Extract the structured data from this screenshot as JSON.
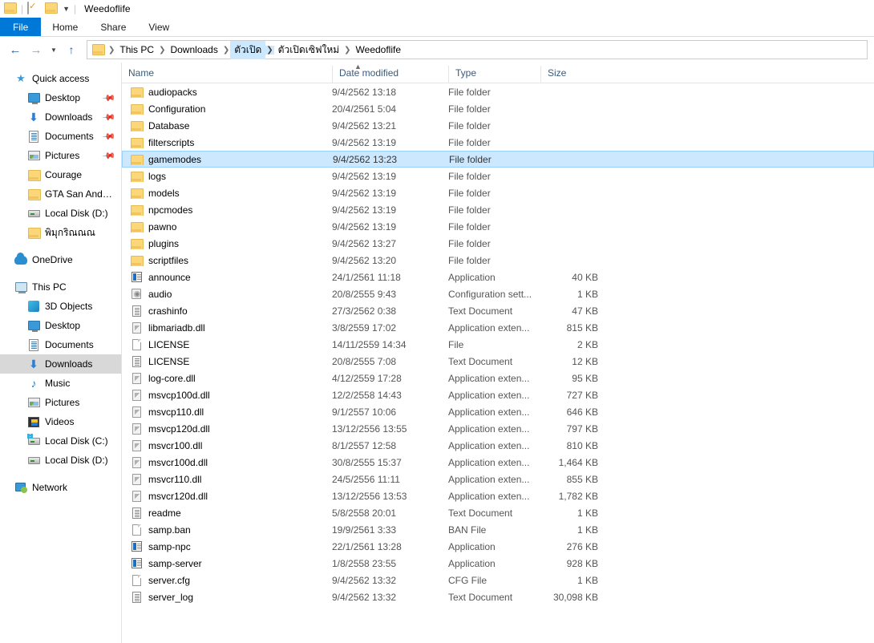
{
  "titlebar": {
    "title": "Weedoflife",
    "qat": [
      "folder-icon",
      "properties-icon",
      "new-folder-icon",
      "customize-dropdown-icon"
    ]
  },
  "ribbon": {
    "tabs": [
      {
        "label": "File",
        "active": true
      },
      {
        "label": "Home",
        "active": false
      },
      {
        "label": "Share",
        "active": false
      },
      {
        "label": "View",
        "active": false
      }
    ]
  },
  "addressbar": {
    "back_icon": "back-arrow-icon",
    "forward_icon": "forward-arrow-icon",
    "recent_icon": "recent-locations-icon",
    "up_icon": "up-arrow-icon",
    "crumbs": [
      {
        "label": "This PC",
        "highlight": false
      },
      {
        "label": "Downloads",
        "highlight": false
      },
      {
        "label": "ตัวเปิด",
        "highlight": true
      },
      {
        "label": "ตัวเปิดเซิฟใหม่",
        "highlight": false
      },
      {
        "label": "Weedoflife",
        "highlight": false
      }
    ]
  },
  "navpane": {
    "items": [
      {
        "label": "Quick access",
        "icon": "star-icon",
        "level": 0,
        "pinned": false,
        "selected": false
      },
      {
        "label": "Desktop",
        "icon": "monitor-icon",
        "level": 1,
        "pinned": true,
        "selected": false
      },
      {
        "label": "Downloads",
        "icon": "download-arrow-icon",
        "level": 1,
        "pinned": true,
        "selected": false
      },
      {
        "label": "Documents",
        "icon": "document-icon",
        "level": 1,
        "pinned": true,
        "selected": false
      },
      {
        "label": "Pictures",
        "icon": "picture-icon",
        "level": 1,
        "pinned": true,
        "selected": false
      },
      {
        "label": "Courage",
        "icon": "folder-icon",
        "level": 1,
        "pinned": false,
        "selected": false
      },
      {
        "label": "GTA San Andreas",
        "icon": "folder-icon",
        "level": 1,
        "pinned": false,
        "selected": false
      },
      {
        "label": "Local Disk (D:)",
        "icon": "drive-icon",
        "level": 1,
        "pinned": false,
        "selected": false
      },
      {
        "label": "พิมุกริณณณ",
        "icon": "folder-icon",
        "level": 1,
        "pinned": false,
        "selected": false
      },
      {
        "gap": true
      },
      {
        "label": "OneDrive",
        "icon": "cloud-icon",
        "level": 0,
        "pinned": false,
        "selected": false
      },
      {
        "gap": true
      },
      {
        "label": "This PC",
        "icon": "pc-icon",
        "level": 0,
        "pinned": false,
        "selected": false
      },
      {
        "label": "3D Objects",
        "icon": "3d-objects-icon",
        "level": 1,
        "pinned": false,
        "selected": false
      },
      {
        "label": "Desktop",
        "icon": "monitor-icon",
        "level": 1,
        "pinned": false,
        "selected": false
      },
      {
        "label": "Documents",
        "icon": "document-icon",
        "level": 1,
        "pinned": false,
        "selected": false
      },
      {
        "label": "Downloads",
        "icon": "download-arrow-icon",
        "level": 1,
        "pinned": false,
        "selected": true
      },
      {
        "label": "Music",
        "icon": "music-note-icon",
        "level": 1,
        "pinned": false,
        "selected": false
      },
      {
        "label": "Pictures",
        "icon": "picture-icon",
        "level": 1,
        "pinned": false,
        "selected": false
      },
      {
        "label": "Videos",
        "icon": "video-icon",
        "level": 1,
        "pinned": false,
        "selected": false
      },
      {
        "label": "Local Disk (C:)",
        "icon": "system-drive-icon",
        "level": 1,
        "pinned": false,
        "selected": false
      },
      {
        "label": "Local Disk (D:)",
        "icon": "drive-icon",
        "level": 1,
        "pinned": false,
        "selected": false
      },
      {
        "gap": true
      },
      {
        "label": "Network",
        "icon": "network-icon",
        "level": 0,
        "pinned": false,
        "selected": false
      }
    ]
  },
  "listview": {
    "columns": [
      {
        "key": "name",
        "label": "Name",
        "sort": "asc"
      },
      {
        "key": "date",
        "label": "Date modified",
        "sort": ""
      },
      {
        "key": "type",
        "label": "Type",
        "sort": ""
      },
      {
        "key": "size",
        "label": "Size",
        "sort": ""
      }
    ],
    "rows": [
      {
        "name": "audiopacks",
        "date": "9/4/2562 13:18",
        "type": "File folder",
        "size": "",
        "icon": "folder-icon",
        "selected": false
      },
      {
        "name": "Configuration",
        "date": "20/4/2561 5:04",
        "type": "File folder",
        "size": "",
        "icon": "folder-icon",
        "selected": false
      },
      {
        "name": "Database",
        "date": "9/4/2562 13:21",
        "type": "File folder",
        "size": "",
        "icon": "folder-icon",
        "selected": false
      },
      {
        "name": "filterscripts",
        "date": "9/4/2562 13:19",
        "type": "File folder",
        "size": "",
        "icon": "folder-icon",
        "selected": false
      },
      {
        "name": "gamemodes",
        "date": "9/4/2562 13:23",
        "type": "File folder",
        "size": "",
        "icon": "folder-icon",
        "selected": true
      },
      {
        "name": "logs",
        "date": "9/4/2562 13:19",
        "type": "File folder",
        "size": "",
        "icon": "folder-icon",
        "selected": false
      },
      {
        "name": "models",
        "date": "9/4/2562 13:19",
        "type": "File folder",
        "size": "",
        "icon": "folder-icon",
        "selected": false
      },
      {
        "name": "npcmodes",
        "date": "9/4/2562 13:19",
        "type": "File folder",
        "size": "",
        "icon": "folder-icon",
        "selected": false
      },
      {
        "name": "pawno",
        "date": "9/4/2562 13:19",
        "type": "File folder",
        "size": "",
        "icon": "folder-icon",
        "selected": false
      },
      {
        "name": "plugins",
        "date": "9/4/2562 13:27",
        "type": "File folder",
        "size": "",
        "icon": "folder-icon",
        "selected": false
      },
      {
        "name": "scriptfiles",
        "date": "9/4/2562 13:20",
        "type": "File folder",
        "size": "",
        "icon": "folder-icon",
        "selected": false
      },
      {
        "name": "announce",
        "date": "24/1/2561 11:18",
        "type": "Application",
        "size": "40 KB",
        "icon": "application-icon",
        "selected": false
      },
      {
        "name": "audio",
        "date": "20/8/2555 9:43",
        "type": "Configuration sett...",
        "size": "1 KB",
        "icon": "config-icon",
        "selected": false
      },
      {
        "name": "crashinfo",
        "date": "27/3/2562 0:38",
        "type": "Text Document",
        "size": "47 KB",
        "icon": "text-document-icon",
        "selected": false
      },
      {
        "name": "libmariadb.dll",
        "date": "3/8/2559 17:02",
        "type": "Application exten...",
        "size": "815 KB",
        "icon": "dll-icon",
        "selected": false
      },
      {
        "name": "LICENSE",
        "date": "14/11/2559 14:34",
        "type": "File",
        "size": "2 KB",
        "icon": "blank-file-icon",
        "selected": false
      },
      {
        "name": "LICENSE",
        "date": "20/8/2555 7:08",
        "type": "Text Document",
        "size": "12 KB",
        "icon": "text-document-icon",
        "selected": false
      },
      {
        "name": "log-core.dll",
        "date": "4/12/2559 17:28",
        "type": "Application exten...",
        "size": "95 KB",
        "icon": "dll-icon",
        "selected": false
      },
      {
        "name": "msvcp100d.dll",
        "date": "12/2/2558 14:43",
        "type": "Application exten...",
        "size": "727 KB",
        "icon": "dll-icon",
        "selected": false
      },
      {
        "name": "msvcp110.dll",
        "date": "9/1/2557 10:06",
        "type": "Application exten...",
        "size": "646 KB",
        "icon": "dll-icon",
        "selected": false
      },
      {
        "name": "msvcp120d.dll",
        "date": "13/12/2556 13:55",
        "type": "Application exten...",
        "size": "797 KB",
        "icon": "dll-icon",
        "selected": false
      },
      {
        "name": "msvcr100.dll",
        "date": "8/1/2557 12:58",
        "type": "Application exten...",
        "size": "810 KB",
        "icon": "dll-icon",
        "selected": false
      },
      {
        "name": "msvcr100d.dll",
        "date": "30/8/2555 15:37",
        "type": "Application exten...",
        "size": "1,464 KB",
        "icon": "dll-icon",
        "selected": false
      },
      {
        "name": "msvcr110.dll",
        "date": "24/5/2556 11:11",
        "type": "Application exten...",
        "size": "855 KB",
        "icon": "dll-icon",
        "selected": false
      },
      {
        "name": "msvcr120d.dll",
        "date": "13/12/2556 13:53",
        "type": "Application exten...",
        "size": "1,782 KB",
        "icon": "dll-icon",
        "selected": false
      },
      {
        "name": "readme",
        "date": "5/8/2558 20:01",
        "type": "Text Document",
        "size": "1 KB",
        "icon": "text-document-icon",
        "selected": false
      },
      {
        "name": "samp.ban",
        "date": "19/9/2561 3:33",
        "type": "BAN File",
        "size": "1 KB",
        "icon": "blank-file-icon",
        "selected": false
      },
      {
        "name": "samp-npc",
        "date": "22/1/2561 13:28",
        "type": "Application",
        "size": "276 KB",
        "icon": "application-icon",
        "selected": false
      },
      {
        "name": "samp-server",
        "date": "1/8/2558 23:55",
        "type": "Application",
        "size": "928 KB",
        "icon": "application-icon",
        "selected": false
      },
      {
        "name": "server.cfg",
        "date": "9/4/2562 13:32",
        "type": "CFG File",
        "size": "1 KB",
        "icon": "blank-file-icon",
        "selected": false
      },
      {
        "name": "server_log",
        "date": "9/4/2562 13:32",
        "type": "Text Document",
        "size": "30,098 KB",
        "icon": "text-document-icon",
        "selected": false
      }
    ]
  },
  "colors": {
    "accent": "#0078d7",
    "selection_fill": "#cce8ff",
    "selection_border": "#99d1ff",
    "nav_selection": "#d8d8d8",
    "header_text": "#3c5a78",
    "folder_yellow": "#fbd779"
  }
}
